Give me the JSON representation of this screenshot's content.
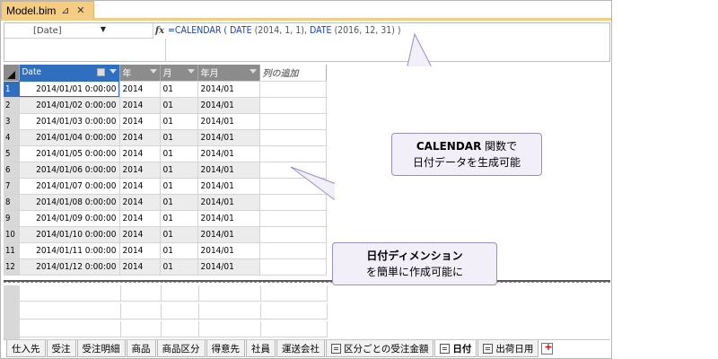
{
  "document": {
    "tab_title": "Model.bim",
    "pin_glyph": "⊿",
    "close_glyph": "✕"
  },
  "formula_bar": {
    "column_selector": "[Date]",
    "fx_label": "fx",
    "formula_parts": [
      {
        "t": "=CALENDAR ( ",
        "c": "kw"
      },
      {
        "t": "DATE ",
        "c": "kw"
      },
      {
        "t": "(2014, 1, 1), ",
        "c": "nm"
      },
      {
        "t": "DATE ",
        "c": "kw"
      },
      {
        "t": "(2016, 12, 31) )",
        "c": "nm"
      }
    ]
  },
  "grid": {
    "headers": {
      "date": "Date",
      "year": "年",
      "month": "月",
      "year_month": "年月",
      "add_column": "列の追加"
    },
    "rows": [
      {
        "n": "1",
        "date": "2014/01/01 0:00:00",
        "year": "2014",
        "month": "01",
        "ym": "2014/01"
      },
      {
        "n": "2",
        "date": "2014/01/02 0:00:00",
        "year": "2014",
        "month": "01",
        "ym": "2014/01"
      },
      {
        "n": "3",
        "date": "2014/01/03 0:00:00",
        "year": "2014",
        "month": "01",
        "ym": "2014/01"
      },
      {
        "n": "4",
        "date": "2014/01/04 0:00:00",
        "year": "2014",
        "month": "01",
        "ym": "2014/01"
      },
      {
        "n": "5",
        "date": "2014/01/05 0:00:00",
        "year": "2014",
        "month": "01",
        "ym": "2014/01"
      },
      {
        "n": "6",
        "date": "2014/01/06 0:00:00",
        "year": "2014",
        "month": "01",
        "ym": "2014/01"
      },
      {
        "n": "7",
        "date": "2014/01/07 0:00:00",
        "year": "2014",
        "month": "01",
        "ym": "2014/01"
      },
      {
        "n": "8",
        "date": "2014/01/08 0:00:00",
        "year": "2014",
        "month": "01",
        "ym": "2014/01"
      },
      {
        "n": "9",
        "date": "2014/01/09 0:00:00",
        "year": "2014",
        "month": "01",
        "ym": "2014/01"
      },
      {
        "n": "10",
        "date": "2014/01/10 0:00:00",
        "year": "2014",
        "month": "01",
        "ym": "2014/01"
      },
      {
        "n": "11",
        "date": "2014/01/11 0:00:00",
        "year": "2014",
        "month": "01",
        "ym": "2014/01"
      },
      {
        "n": "12",
        "date": "2014/01/12 0:00:00",
        "year": "2014",
        "month": "01",
        "ym": "2014/01"
      }
    ]
  },
  "callouts": {
    "calendar_bold": "CALENDAR",
    "calendar_rest": " 関数で",
    "calendar_line2": "日付データを生成可能",
    "dimension_bold": "日付ディメンション",
    "dimension_line2": "を簡単に作成可能に"
  },
  "sheet_tabs": [
    {
      "label": "仕入先",
      "icon": false,
      "active": false
    },
    {
      "label": "受注",
      "icon": false,
      "active": false
    },
    {
      "label": "受注明細",
      "icon": false,
      "active": false
    },
    {
      "label": "商品",
      "icon": false,
      "active": false
    },
    {
      "label": "商品区分",
      "icon": false,
      "active": false
    },
    {
      "label": "得意先",
      "icon": false,
      "active": false
    },
    {
      "label": "社員",
      "icon": false,
      "active": false
    },
    {
      "label": "運送会社",
      "icon": false,
      "active": false
    },
    {
      "label": "区分ごとの受注金額",
      "icon": true,
      "active": false
    },
    {
      "label": "日付",
      "icon": true,
      "active": true
    },
    {
      "label": "出荷日用",
      "icon": true,
      "active": false
    }
  ],
  "colors": {
    "header_gray": "#8c8c8c",
    "selection_blue": "#2f6fc0",
    "doc_tab": "#f5cc84",
    "callout_fill": "#f3eff8",
    "callout_border": "#9a8ec2",
    "formula_keyword": "#1a3fc7"
  }
}
